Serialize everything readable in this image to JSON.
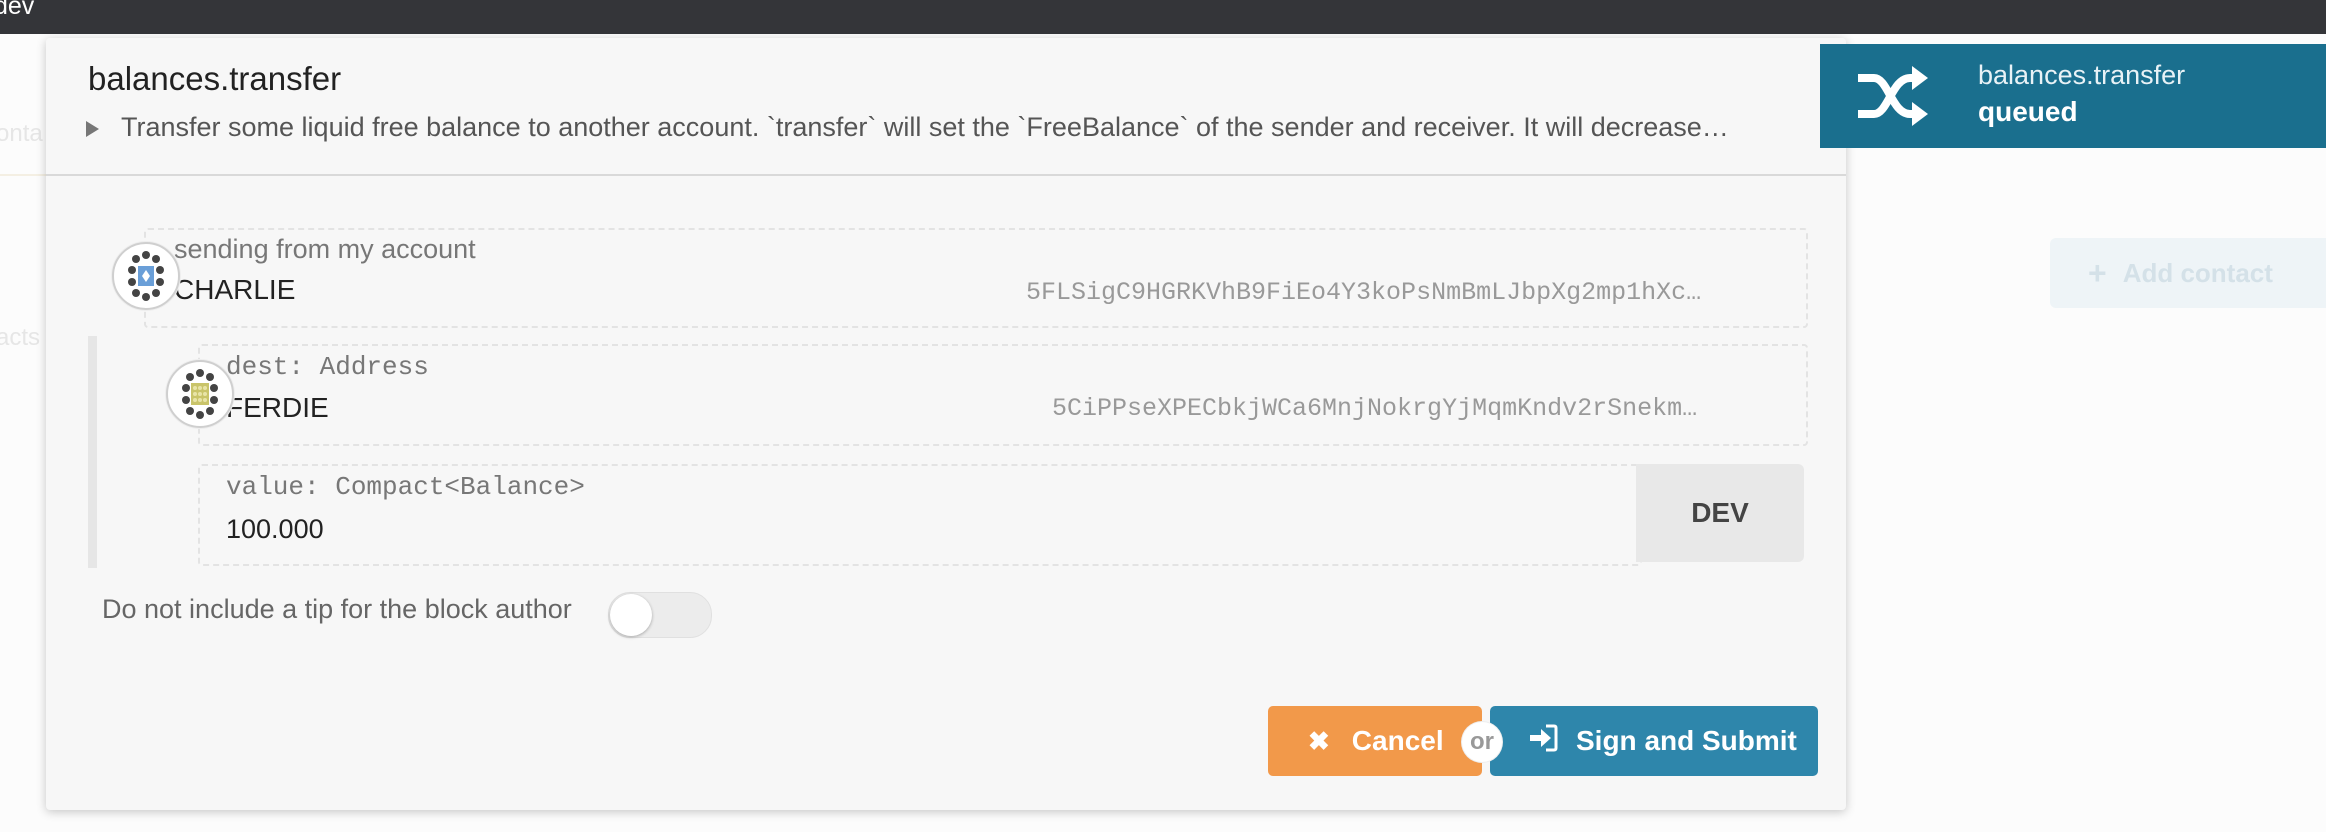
{
  "topbar": {
    "label": "dev"
  },
  "background": {
    "fragment1": "onta",
    "fragment2": "acts",
    "add_contact_label": "Add contact"
  },
  "modal": {
    "title": "balances.transfer",
    "description": "Transfer some liquid free balance to another account. `transfer` will set the `FreeBalance` of the sender and receiver. It will decrease…",
    "sender": {
      "label": "sending from my account",
      "name": "CHARLIE",
      "address": "5FLSigC9HGRKVhB9FiEo4Y3koPsNmBmLJbpXg2mp1hXc…"
    },
    "dest": {
      "label": "dest: Address",
      "name": "FERDIE",
      "address": "5CiPPseXPECbkjWCa6MnjNokrgYjMqmKndv2rSnekm…"
    },
    "value": {
      "label": "value: Compact<Balance>",
      "amount": "100.000",
      "unit": "DEV"
    },
    "tip_label": "Do not include a tip for the block author",
    "tip_enabled": false,
    "cancel_label": "Cancel",
    "or_label": "or",
    "submit_label": "Sign and Submit",
    "colors": {
      "cancel": "#f2994a",
      "submit": "#2e86ab"
    }
  },
  "notification": {
    "title": "balances.transfer",
    "status": "queued",
    "icon": "shuffle-icon",
    "color": "#1a6f8e"
  }
}
